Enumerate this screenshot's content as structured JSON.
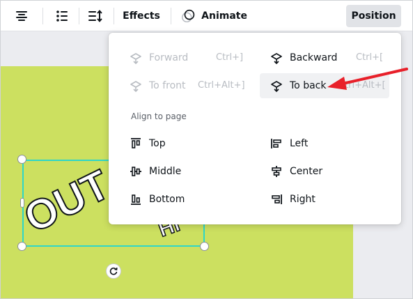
{
  "toolbar": {
    "effects_label": "Effects",
    "animate_label": "Animate",
    "position_label": "Position"
  },
  "menu": {
    "forward": {
      "label": "Forward",
      "shortcut": "Ctrl+]"
    },
    "to_front": {
      "label": "To front",
      "shortcut": "Ctrl+Alt+]"
    },
    "backward": {
      "label": "Backward",
      "shortcut": "Ctrl+["
    },
    "to_back": {
      "label": "To back",
      "shortcut": "Ctrl+Alt+["
    },
    "align_heading": "Align to page",
    "align": {
      "top": "Top",
      "middle": "Middle",
      "bottom": "Bottom",
      "left": "Left",
      "center": "Center",
      "right": "Right"
    }
  },
  "canvas": {
    "text_line1": "OUT",
    "text_line2": "HI"
  },
  "colors": {
    "page_background": "#cce060",
    "selection": "#2ed6c8",
    "annotation_arrow": "#e8202a"
  }
}
